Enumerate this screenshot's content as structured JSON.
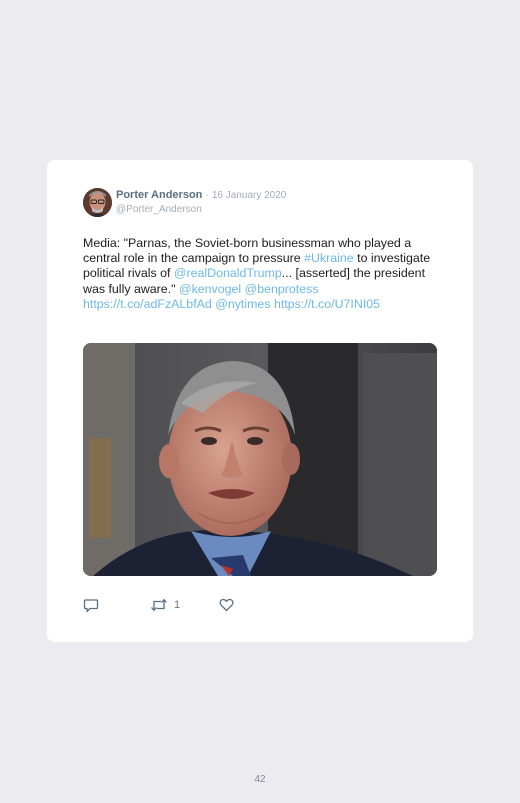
{
  "tweet": {
    "author_name": "Porter Anderson",
    "separator": "·",
    "date": "16 January 2020",
    "handle": "@Porter_Anderson",
    "text_segments": [
      {
        "text": "Media: \"Parnas, the Soviet-born businessman who played a central role in the campaign to pressure ",
        "link": false
      },
      {
        "text": "#Ukraine",
        "link": true
      },
      {
        "text": " to investigate political rivals of ",
        "link": false
      },
      {
        "text": "@realDonaldTrump",
        "link": true
      },
      {
        "text": "... [asserted] the president was fully aware.\" ",
        "link": false
      },
      {
        "text": "@kenvogel",
        "link": true
      },
      {
        "text": " ",
        "link": false
      },
      {
        "text": "@benprotess",
        "link": true
      },
      {
        "text": " ",
        "link": false
      },
      {
        "text": "https://t.co/adFzALbfAd",
        "link": true
      },
      {
        "text": " ",
        "link": false
      },
      {
        "text": "@nytimes",
        "link": true
      },
      {
        "text": " ",
        "link": false
      },
      {
        "text": "https://t.co/U7INI05",
        "link": true
      }
    ],
    "retweet_count": "1"
  },
  "icons": {
    "reply": "reply-icon",
    "retweet": "retweet-icon",
    "like": "heart-icon"
  },
  "colors": {
    "background": "#ebebf0",
    "card": "#ffffff",
    "link": "#6eb9e8",
    "author": "#5b6f82",
    "muted": "#a2adb8"
  },
  "page": {
    "number": "42"
  }
}
